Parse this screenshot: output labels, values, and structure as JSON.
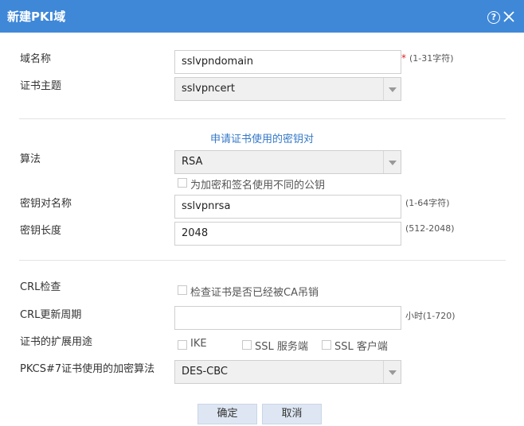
{
  "dialog": {
    "title": "新建PKI域",
    "help_symbol": "?"
  },
  "form": {
    "domain_name": {
      "label": "域名称",
      "value": "sslvpndomain",
      "required_mark": "*",
      "hint": "(1-31字符)"
    },
    "cert_subject": {
      "label": "证书主题",
      "value": "sslvpncert"
    },
    "keypair_section": {
      "title": "申请证书使用的密钥对"
    },
    "algorithm": {
      "label": "算法",
      "value": "RSA"
    },
    "different_keys": {
      "label": "为加密和签名使用不同的公钥",
      "checked": false
    },
    "keypair_name": {
      "label": "密钥对名称",
      "value": "sslvpnrsa",
      "hint": "(1-64字符)"
    },
    "key_length": {
      "label": "密钥长度",
      "value": "2048",
      "hint": "(512-2048)"
    },
    "crl_check": {
      "label": "CRL检查",
      "checkbox_label": "检查证书是否已经被CA吊销",
      "checked": false
    },
    "crl_period": {
      "label": "CRL更新周期",
      "value": "",
      "hint": "小时(1-720)"
    },
    "ext_usage": {
      "label": "证书的扩展用途",
      "options": [
        {
          "label": "IKE",
          "checked": false
        },
        {
          "label": "SSL 服务端",
          "checked": false
        },
        {
          "label": "SSL 客户端",
          "checked": false
        }
      ]
    },
    "pkcs7_algorithm": {
      "label": "PKCS#7证书使用的加密算法",
      "value": "DES-CBC"
    }
  },
  "buttons": {
    "ok": "确定",
    "cancel": "取消"
  },
  "colors": {
    "titlebar": "#3f88d8",
    "section_title": "#3478c8",
    "required": "#e02020",
    "button_bg": "#dde6f2"
  }
}
